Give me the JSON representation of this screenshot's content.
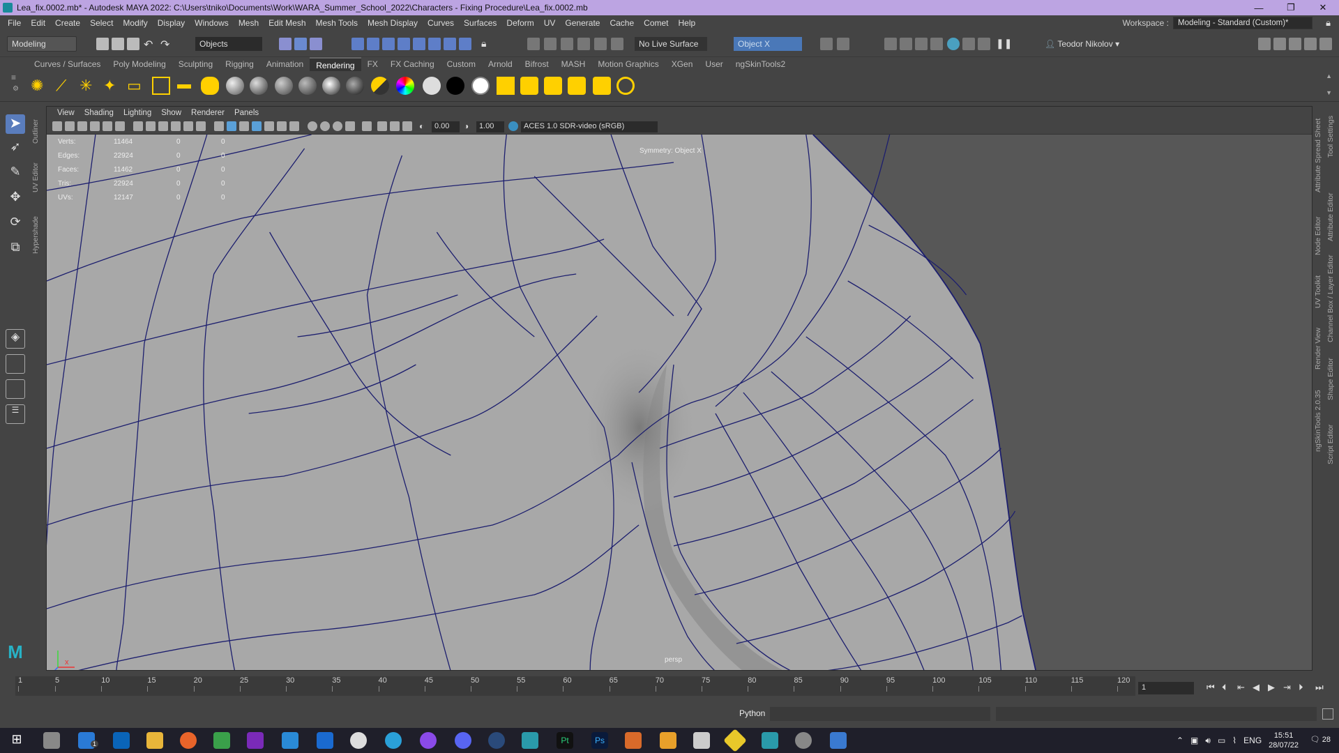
{
  "window": {
    "title": "Lea_fix.0002.mb* - Autodesk MAYA 2022: C:\\Users\\tniko\\Documents\\Work\\WARA_Summer_School_2022\\Characters - Fixing Procedure\\Lea_fix.0002.mb",
    "minimize": "—",
    "restore": "❐",
    "close": "✕"
  },
  "menu": [
    "File",
    "Edit",
    "Create",
    "Select",
    "Modify",
    "Display",
    "Windows",
    "Mesh",
    "Edit Mesh",
    "Mesh Tools",
    "Mesh Display",
    "Curves",
    "Surfaces",
    "Deform",
    "UV",
    "Generate",
    "Cache",
    "Comet",
    "Help"
  ],
  "workspace": {
    "label": "Workspace :",
    "value": "Modeling - Standard (Custom)*"
  },
  "status": {
    "mode": "Modeling",
    "selection_mask": "Objects",
    "live_surface": "No Live Surface",
    "symmetry": "Object X",
    "user": "Teodor Nikolov"
  },
  "shelf_tabs": [
    "Curves / Surfaces",
    "Poly Modeling",
    "Sculpting",
    "Rigging",
    "Animation",
    "Rendering",
    "FX",
    "FX Caching",
    "Custom",
    "Arnold",
    "Bifrost",
    "MASH",
    "Motion Graphics",
    "XGen",
    "User",
    "ngSkinTools2"
  ],
  "active_shelf": "Rendering",
  "panel_menu": [
    "View",
    "Shading",
    "Lighting",
    "Show",
    "Renderer",
    "Panels"
  ],
  "panel_toolbar": {
    "exposure": "0.00",
    "gamma": "1.00",
    "color_space": "ACES 1.0 SDR-video (sRGB)"
  },
  "hud": [
    {
      "label": "Verts:",
      "v1": "11464",
      "v2": "0",
      "v3": "0"
    },
    {
      "label": "Edges:",
      "v1": "22924",
      "v2": "0",
      "v3": "0"
    },
    {
      "label": "Faces:",
      "v1": "11462",
      "v2": "0",
      "v3": "0"
    },
    {
      "label": "Tris:",
      "v1": "22924",
      "v2": "0",
      "v3": "0"
    },
    {
      "label": "UVs:",
      "v1": "12147",
      "v2": "0",
      "v3": "0"
    }
  ],
  "viewport": {
    "symmetry_text": "Symmetry: Object X",
    "camera": "persp"
  },
  "left_vertical_labels": [
    "Outliner",
    "UV Editor",
    "Hypershade"
  ],
  "right_vertical_labels": [
    "Tool Settings",
    "Attribute Spread Sheet",
    "Attribute Editor",
    "Node Editor",
    "Channel Box / Layer Editor",
    "UV Toolkit",
    "Render View",
    "Shape Editor",
    "ngSkinTools 2.0.35",
    "Script Editor"
  ],
  "timeline": {
    "ticks": [
      "1",
      "5",
      "10",
      "15",
      "20",
      "25",
      "30",
      "35",
      "40",
      "45",
      "50",
      "55",
      "60",
      "65",
      "70",
      "75",
      "80",
      "85",
      "90",
      "95",
      "100",
      "105",
      "110",
      "115",
      "120"
    ],
    "current_frame": "1"
  },
  "command_line": {
    "language": "Python"
  },
  "taskbar": {
    "time": "15:51",
    "date": "28/07/22",
    "lang": "ENG",
    "notifications": "28",
    "mail_badge": "1"
  },
  "colors": {
    "title_bar": "#bca4e2",
    "wire": "#1c1e6e",
    "mesh": "#a8a8a8",
    "viewport_bg": "#575757"
  }
}
